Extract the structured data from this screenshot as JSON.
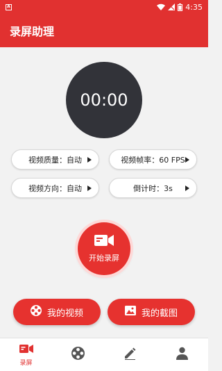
{
  "status_bar": {
    "notification_glyph": "A",
    "time": "4:35",
    "icons": [
      "wifi-icon",
      "signal-icon",
      "battery-icon"
    ]
  },
  "app_bar": {
    "title": "录屏助理"
  },
  "timer": {
    "display": "00:00"
  },
  "settings": {
    "quality": "视频质量：自动",
    "framerate": "视频帧率：60 FPS",
    "orientation": "视频方向：自动",
    "countdown": "倒计时：3s"
  },
  "record_button": {
    "label": "开始录屏",
    "icon": "video-camera-icon"
  },
  "actions": {
    "my_videos": {
      "label": "我的视频",
      "icon": "film-reel-icon"
    },
    "my_screenshots": {
      "label": "我的截图",
      "icon": "image-icon"
    }
  },
  "bottom_nav": {
    "items": [
      {
        "label": "录屏",
        "icon": "video-camera-icon",
        "active": true
      },
      {
        "label": "",
        "icon": "film-reel-icon",
        "active": false
      },
      {
        "label": "",
        "icon": "pencil-icon",
        "active": false
      },
      {
        "label": "",
        "icon": "person-icon",
        "active": false
      }
    ]
  },
  "colors": {
    "accent": "#e13130",
    "button_red": "#e6322f",
    "timer_bg": "#323339",
    "background": "#f2f2f2",
    "nav_inactive": "#555555"
  }
}
